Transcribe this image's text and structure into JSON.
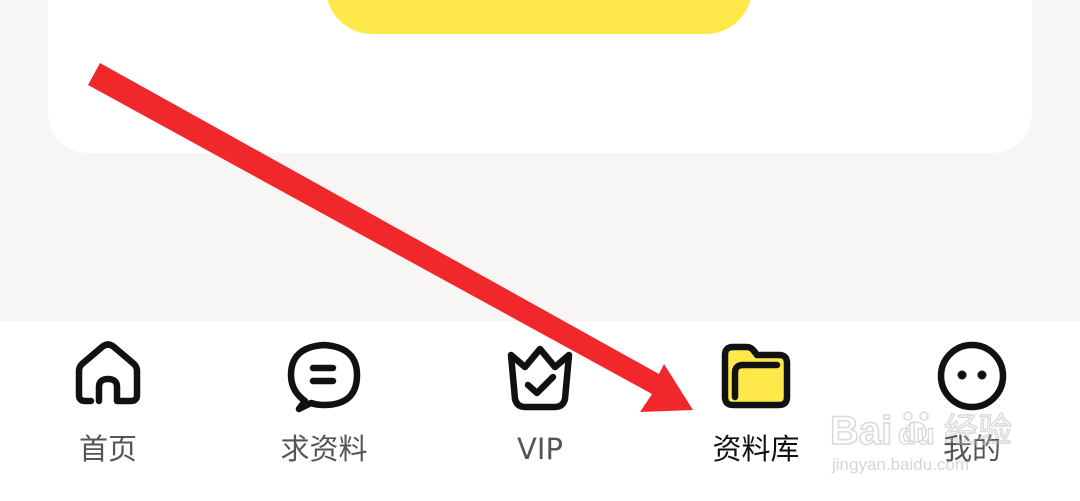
{
  "tabs": [
    {
      "label": "首页",
      "icon": "home-icon",
      "active": false
    },
    {
      "label": "求资料",
      "icon": "chat-bubble-icon",
      "active": false
    },
    {
      "label": "VIP",
      "icon": "crown-check-icon",
      "active": false
    },
    {
      "label": "资料库",
      "icon": "folder-icon",
      "active": true
    },
    {
      "label": "我的",
      "icon": "smiley-face-icon",
      "active": false
    }
  ],
  "colors": {
    "accent_yellow": "#ffe94a",
    "icon_dark": "#111111",
    "label_inactive": "#555555",
    "label_active": "#111111",
    "annotation_red": "#f0282c",
    "page_background": "#f7f6f4"
  },
  "watermark": {
    "brand_text": "Bai",
    "brand_text_suffix": "du",
    "product_text": "经验",
    "url": "jingyan.baidu.com"
  }
}
